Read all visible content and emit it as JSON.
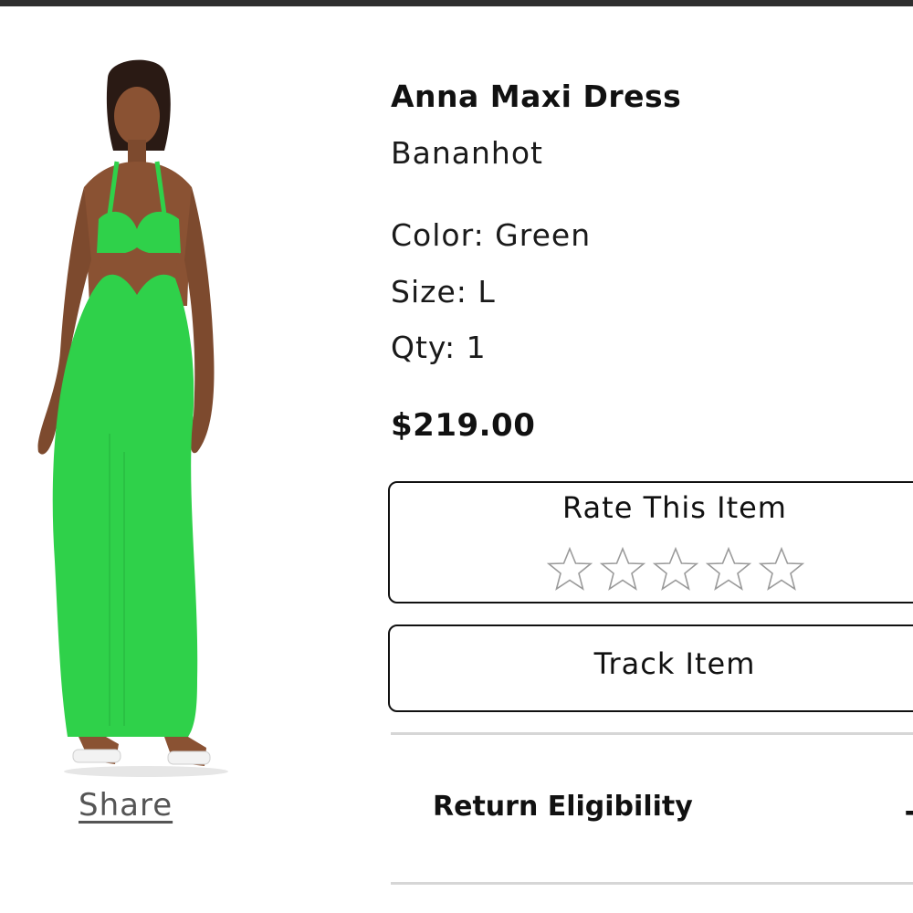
{
  "product": {
    "title": "Anna Maxi Dress",
    "brand": "Bananhot",
    "color_line": "Color: Green",
    "size_line": "Size: L",
    "qty_line": "Qty: 1",
    "price": "$219.00",
    "image_icon": "green-maxi-dress-photo",
    "dress_color": "#2fd14a"
  },
  "share": {
    "label": "Share"
  },
  "rating": {
    "title": "Rate This Item",
    "stars_total": 5,
    "stars_selected": 0
  },
  "track": {
    "label": "Track Item"
  },
  "return_eligibility": {
    "label": "Return Eligibility",
    "icon": "plus-icon",
    "symbol": "+"
  },
  "colors": {
    "topbar": "#2f2f2f",
    "border": "#111111",
    "divider": "#d6d6d6",
    "link": "#555555"
  }
}
